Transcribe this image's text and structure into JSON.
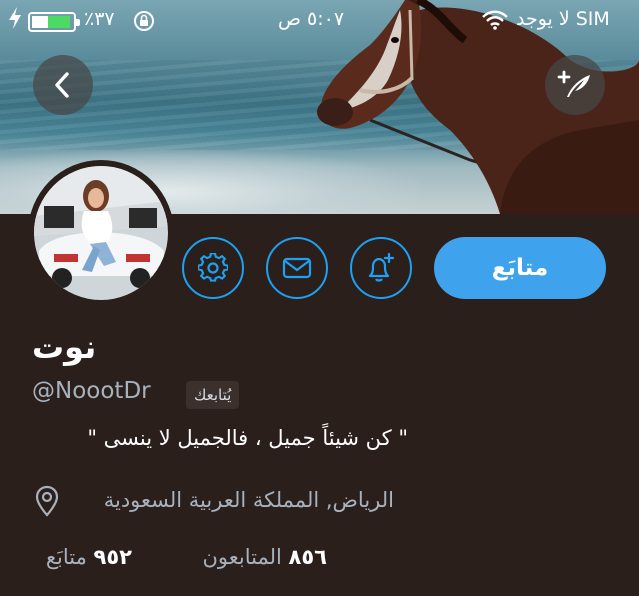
{
  "status_bar": {
    "carrier": "لا يوجد SIM",
    "time": "٥:٠٧ ص",
    "battery_percent": "٪٣٧",
    "battery_level": 0.37
  },
  "header": {
    "back_icon": "chevron-left-icon",
    "compose_icon": "feather-plus-icon"
  },
  "profile": {
    "follow_label": "متابَع",
    "display_name": "نوت",
    "handle": "@NoootDr",
    "follows_you_label": "يُتابعك",
    "bio": "\" كن شيئاً جميل ، فالجميل لا ينسى \"",
    "location": "الرياض, المملكة العربية السعودية",
    "stats": {
      "following_count": "٩٥٢",
      "following_label": "متابَع",
      "followers_count": "٨٥٦",
      "followers_label": "المتابعون"
    }
  },
  "colors": {
    "accent": "#1da1f2",
    "follow_button": "#3ea3ec",
    "background": "#2b1f1c",
    "secondary_text": "#a6b2bd"
  }
}
